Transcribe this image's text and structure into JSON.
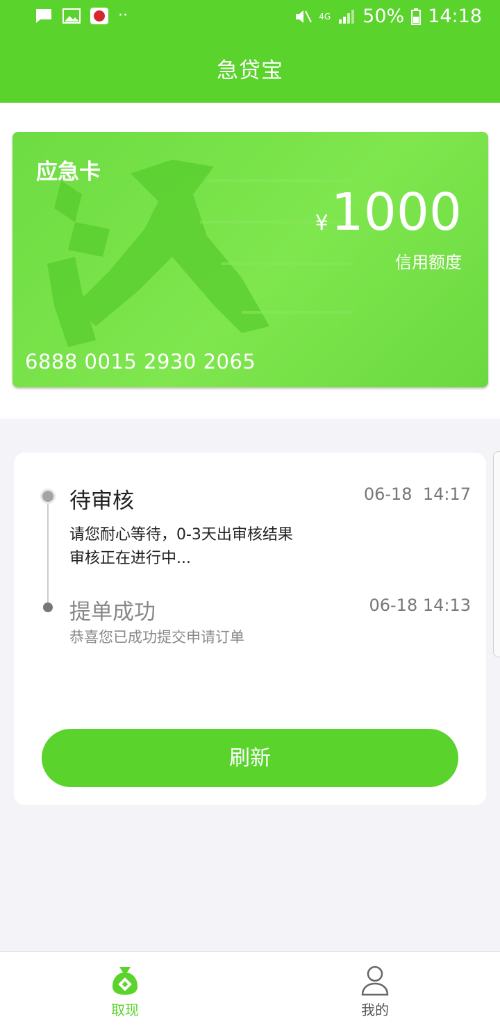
{
  "status_bar": {
    "battery": "50%",
    "time": "14:18",
    "network": "4G",
    "icons": [
      "message-icon",
      "gallery-icon",
      "app-notification-icon",
      "more-dots-icon",
      "mute-icon",
      "signal-icon",
      "battery-icon"
    ]
  },
  "header": {
    "title": "急贷宝"
  },
  "card": {
    "title": "应急卡",
    "currency": "¥",
    "amount": "1000",
    "credit_label": "信用额度",
    "card_number": "6888 0015 2930 2065"
  },
  "timeline": {
    "steps": [
      {
        "title": "待审核",
        "time": "06-18  14:17",
        "desc_line1": "请您耐心等待，0-3天出审核结果",
        "desc_line2": "审核正在进行中..."
      },
      {
        "title": "提单成功",
        "time": "06-18 14:13",
        "desc": "恭喜您已成功提交申请订单"
      }
    ],
    "refresh_label": "刷新"
  },
  "tab_bar": {
    "tabs": [
      {
        "label": "取现",
        "icon": "money-bag-icon",
        "active": true
      },
      {
        "label": "我的",
        "icon": "user-icon",
        "active": false
      }
    ]
  },
  "colors": {
    "brand_green": "#5ad32c",
    "background": "#f4f4f8"
  }
}
